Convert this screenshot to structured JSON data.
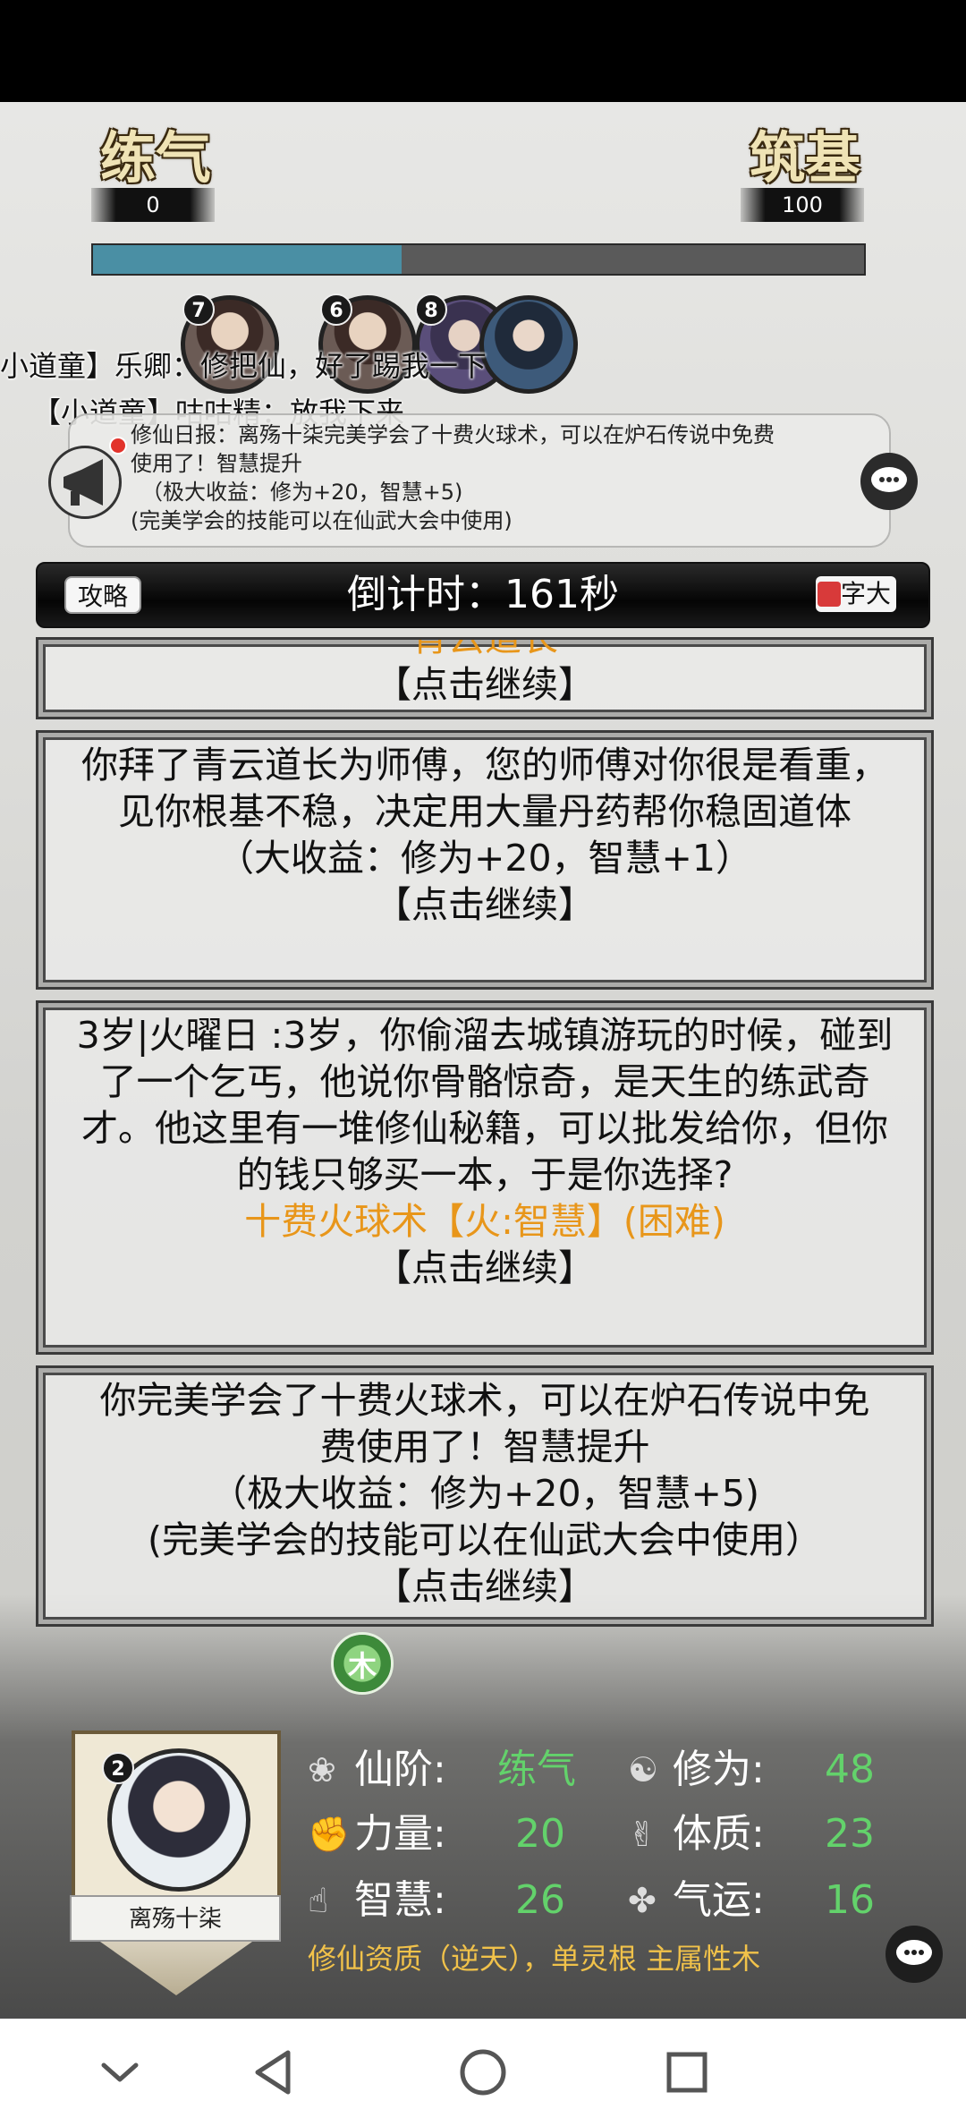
{
  "realm": {
    "current_label": "练气",
    "current_value": "0",
    "next_label": "筑基",
    "next_value": "100",
    "progress_fraction": 0.4
  },
  "avatars": [
    {
      "badge": "7"
    },
    {
      "badge": "6"
    },
    {
      "badge": "8"
    },
    {
      "badge": ""
    }
  ],
  "chat": {
    "line1": "小道童】乐卿：修把仙，好了踢我一下",
    "line2": "【小道童】咕咕精：放我下来"
  },
  "notice": {
    "line1": "修仙日报：离殇十柒完美学会了十费火球术，可以在炉石传说中免费",
    "line2": "使用了！智慧提升",
    "line3": "（极大收益：修为+20，智慧+5)",
    "line4": "(完美学会的技能可以在仙武大会中使用)"
  },
  "timer": {
    "strategy_label": "攻略",
    "countdown_text": "倒计时：161秒",
    "font_label": "字大"
  },
  "cards": [
    {
      "partial_title": "青云道长",
      "continue": "【点击继续】"
    },
    {
      "text": "你拜了青云道长为师傅，您的师傅对你很是看重，见你根基不稳，决定用大量丹药帮你稳固道体",
      "reward": "（大收益：修为+20，智慧+1）",
      "continue": "【点击继续】"
    },
    {
      "text": "3岁|火曜日 :3岁，你偷溜去城镇游玩的时候，碰到了一个乞丐，他说你骨骼惊奇，是天生的练武奇才。他这里有一堆修仙秘籍，可以批发给你，但你的钱只够买一本，于是你选择?",
      "choice": "十费火球术【火:智慧】(困难)",
      "continue": "【点击继续】"
    },
    {
      "text": "你完美学会了十费火球术，可以在炉石传说中免费使用了！智慧提升",
      "reward": "（极大收益：修为+20，智慧+5)",
      "note": "(完美学会的技能可以在仙武大会中使用）",
      "continue": "【点击继续】"
    }
  ],
  "element_token": "木",
  "character": {
    "badge": "2",
    "name": "离殇十柒",
    "stats": {
      "realm_label": "仙阶:",
      "realm_value": "练气",
      "cultivation_label": "修为:",
      "cultivation_value": "48",
      "strength_label": "力量:",
      "strength_value": "20",
      "constitution_label": "体质:",
      "constitution_value": "23",
      "wisdom_label": "智慧:",
      "wisdom_value": "26",
      "luck_label": "气运:",
      "luck_value": "16"
    },
    "aptitude": "修仙资质（逆天），单灵根 主属性木"
  },
  "icons": {
    "back": "◁",
    "home": "○",
    "recents": "□",
    "collapse": "∨",
    "chat": "⋯"
  },
  "colors": {
    "progress_fill": "#4a8fa4",
    "stat_value": "#63d26b",
    "choice_orange": "#e8961a",
    "aptitude_gold": "#f1c24a"
  }
}
